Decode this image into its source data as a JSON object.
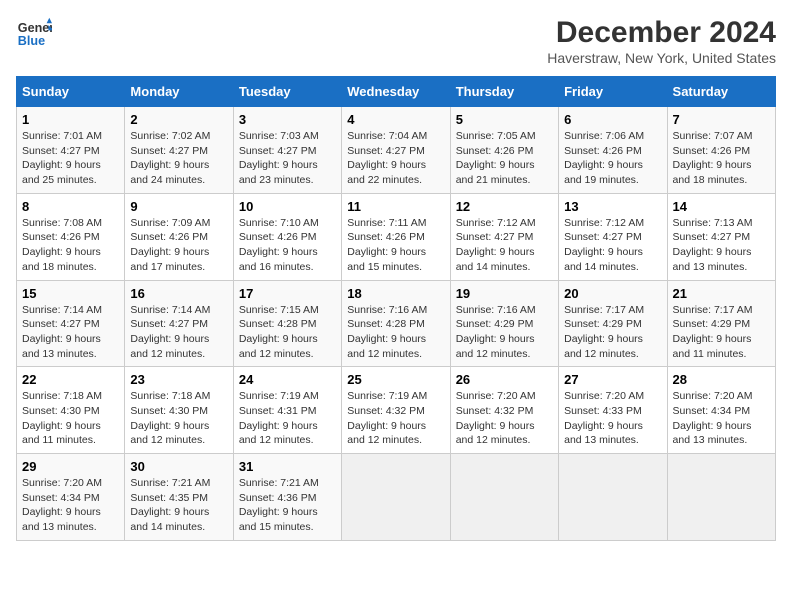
{
  "header": {
    "logo_line1": "General",
    "logo_line2": "Blue",
    "title": "December 2024",
    "subtitle": "Haverstraw, New York, United States"
  },
  "columns": [
    "Sunday",
    "Monday",
    "Tuesday",
    "Wednesday",
    "Thursday",
    "Friday",
    "Saturday"
  ],
  "weeks": [
    [
      {
        "day": "1",
        "rise": "Sunrise: 7:01 AM",
        "set": "Sunset: 4:27 PM",
        "light": "Daylight: 9 hours and 25 minutes."
      },
      {
        "day": "2",
        "rise": "Sunrise: 7:02 AM",
        "set": "Sunset: 4:27 PM",
        "light": "Daylight: 9 hours and 24 minutes."
      },
      {
        "day": "3",
        "rise": "Sunrise: 7:03 AM",
        "set": "Sunset: 4:27 PM",
        "light": "Daylight: 9 hours and 23 minutes."
      },
      {
        "day": "4",
        "rise": "Sunrise: 7:04 AM",
        "set": "Sunset: 4:27 PM",
        "light": "Daylight: 9 hours and 22 minutes."
      },
      {
        "day": "5",
        "rise": "Sunrise: 7:05 AM",
        "set": "Sunset: 4:26 PM",
        "light": "Daylight: 9 hours and 21 minutes."
      },
      {
        "day": "6",
        "rise": "Sunrise: 7:06 AM",
        "set": "Sunset: 4:26 PM",
        "light": "Daylight: 9 hours and 19 minutes."
      },
      {
        "day": "7",
        "rise": "Sunrise: 7:07 AM",
        "set": "Sunset: 4:26 PM",
        "light": "Daylight: 9 hours and 18 minutes."
      }
    ],
    [
      {
        "day": "8",
        "rise": "Sunrise: 7:08 AM",
        "set": "Sunset: 4:26 PM",
        "light": "Daylight: 9 hours and 18 minutes."
      },
      {
        "day": "9",
        "rise": "Sunrise: 7:09 AM",
        "set": "Sunset: 4:26 PM",
        "light": "Daylight: 9 hours and 17 minutes."
      },
      {
        "day": "10",
        "rise": "Sunrise: 7:10 AM",
        "set": "Sunset: 4:26 PM",
        "light": "Daylight: 9 hours and 16 minutes."
      },
      {
        "day": "11",
        "rise": "Sunrise: 7:11 AM",
        "set": "Sunset: 4:26 PM",
        "light": "Daylight: 9 hours and 15 minutes."
      },
      {
        "day": "12",
        "rise": "Sunrise: 7:12 AM",
        "set": "Sunset: 4:27 PM",
        "light": "Daylight: 9 hours and 14 minutes."
      },
      {
        "day": "13",
        "rise": "Sunrise: 7:12 AM",
        "set": "Sunset: 4:27 PM",
        "light": "Daylight: 9 hours and 14 minutes."
      },
      {
        "day": "14",
        "rise": "Sunrise: 7:13 AM",
        "set": "Sunset: 4:27 PM",
        "light": "Daylight: 9 hours and 13 minutes."
      }
    ],
    [
      {
        "day": "15",
        "rise": "Sunrise: 7:14 AM",
        "set": "Sunset: 4:27 PM",
        "light": "Daylight: 9 hours and 13 minutes."
      },
      {
        "day": "16",
        "rise": "Sunrise: 7:14 AM",
        "set": "Sunset: 4:27 PM",
        "light": "Daylight: 9 hours and 12 minutes."
      },
      {
        "day": "17",
        "rise": "Sunrise: 7:15 AM",
        "set": "Sunset: 4:28 PM",
        "light": "Daylight: 9 hours and 12 minutes."
      },
      {
        "day": "18",
        "rise": "Sunrise: 7:16 AM",
        "set": "Sunset: 4:28 PM",
        "light": "Daylight: 9 hours and 12 minutes."
      },
      {
        "day": "19",
        "rise": "Sunrise: 7:16 AM",
        "set": "Sunset: 4:29 PM",
        "light": "Daylight: 9 hours and 12 minutes."
      },
      {
        "day": "20",
        "rise": "Sunrise: 7:17 AM",
        "set": "Sunset: 4:29 PM",
        "light": "Daylight: 9 hours and 12 minutes."
      },
      {
        "day": "21",
        "rise": "Sunrise: 7:17 AM",
        "set": "Sunset: 4:29 PM",
        "light": "Daylight: 9 hours and 11 minutes."
      }
    ],
    [
      {
        "day": "22",
        "rise": "Sunrise: 7:18 AM",
        "set": "Sunset: 4:30 PM",
        "light": "Daylight: 9 hours and 11 minutes."
      },
      {
        "day": "23",
        "rise": "Sunrise: 7:18 AM",
        "set": "Sunset: 4:30 PM",
        "light": "Daylight: 9 hours and 12 minutes."
      },
      {
        "day": "24",
        "rise": "Sunrise: 7:19 AM",
        "set": "Sunset: 4:31 PM",
        "light": "Daylight: 9 hours and 12 minutes."
      },
      {
        "day": "25",
        "rise": "Sunrise: 7:19 AM",
        "set": "Sunset: 4:32 PM",
        "light": "Daylight: 9 hours and 12 minutes."
      },
      {
        "day": "26",
        "rise": "Sunrise: 7:20 AM",
        "set": "Sunset: 4:32 PM",
        "light": "Daylight: 9 hours and 12 minutes."
      },
      {
        "day": "27",
        "rise": "Sunrise: 7:20 AM",
        "set": "Sunset: 4:33 PM",
        "light": "Daylight: 9 hours and 13 minutes."
      },
      {
        "day": "28",
        "rise": "Sunrise: 7:20 AM",
        "set": "Sunset: 4:34 PM",
        "light": "Daylight: 9 hours and 13 minutes."
      }
    ],
    [
      {
        "day": "29",
        "rise": "Sunrise: 7:20 AM",
        "set": "Sunset: 4:34 PM",
        "light": "Daylight: 9 hours and 13 minutes."
      },
      {
        "day": "30",
        "rise": "Sunrise: 7:21 AM",
        "set": "Sunset: 4:35 PM",
        "light": "Daylight: 9 hours and 14 minutes."
      },
      {
        "day": "31",
        "rise": "Sunrise: 7:21 AM",
        "set": "Sunset: 4:36 PM",
        "light": "Daylight: 9 hours and 15 minutes."
      },
      null,
      null,
      null,
      null
    ]
  ]
}
